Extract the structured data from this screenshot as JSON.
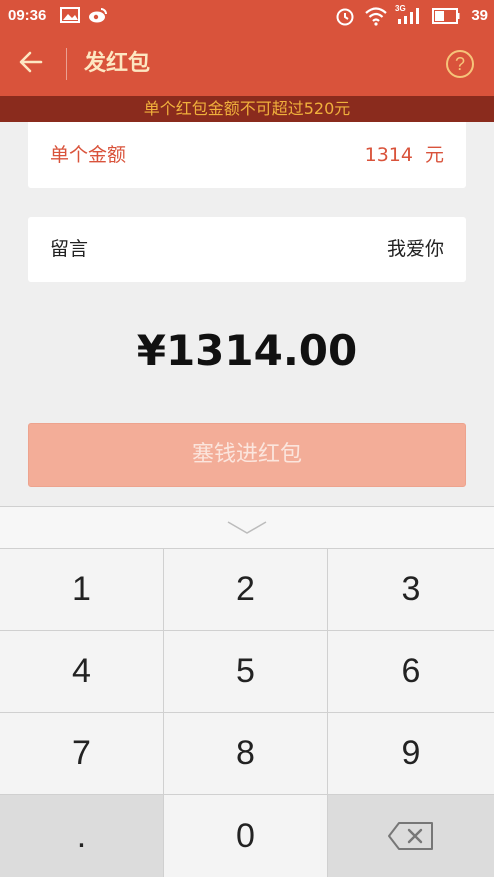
{
  "status_bar": {
    "time": "09:36",
    "network": "3G",
    "battery": "39"
  },
  "header": {
    "title": "发红包",
    "help_symbol": "?"
  },
  "warning": "单个红包金额不可超过520元",
  "amount_row": {
    "label": "单个金额",
    "value": "1314",
    "unit": "元"
  },
  "message_row": {
    "label": "留言",
    "value": "我爱你"
  },
  "total": "¥1314.00",
  "submit_label": "塞钱进红包",
  "keypad": {
    "keys": [
      "1",
      "2",
      "3",
      "4",
      "5",
      "6",
      "7",
      "8",
      "9",
      ".",
      "0"
    ]
  },
  "colors": {
    "brand": "#d9533b",
    "warning_bg": "#8a2b1d",
    "warning_text": "#f0b03c",
    "button_disabled": "#f3ad98"
  },
  "icons": [
    "picture-icon",
    "weibo-icon",
    "alarm-icon",
    "wifi-icon",
    "signal-icon",
    "battery-icon",
    "back-arrow-icon",
    "help-icon",
    "chevron-down-icon",
    "backspace-icon"
  ]
}
